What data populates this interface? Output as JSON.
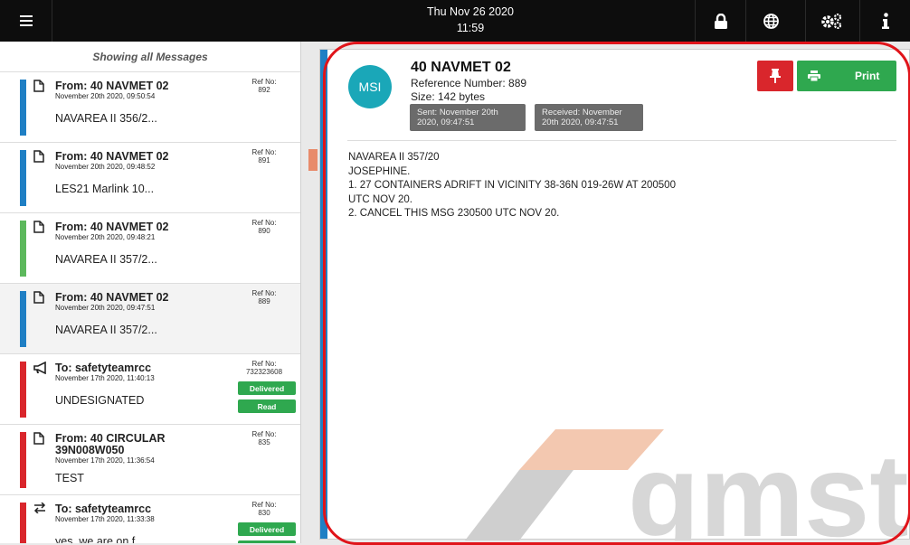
{
  "topbar": {
    "date": "Thu Nov 26 2020",
    "time": "11:59",
    "icons": [
      "menu-icon",
      "lock-icon",
      "globe-icon",
      "gears-icon",
      "info-icon"
    ]
  },
  "list": {
    "header": "Showing all Messages",
    "messages": [
      {
        "type": "file",
        "from": "From: 40 NAVMET 02",
        "date": "November 20th 2020, 09:50:54",
        "ref_label": "Ref No:",
        "ref": "892",
        "snippet": "NAVAREA II 356/2...",
        "color": "#1f7fc4",
        "selected": false,
        "badges": []
      },
      {
        "type": "file",
        "from": "From: 40 NAVMET 02",
        "date": "November 20th 2020, 09:48:52",
        "ref_label": "Ref No:",
        "ref": "891",
        "snippet": "LES21 Marlink 10...",
        "color": "#1f7fc4",
        "selected": false,
        "badges": []
      },
      {
        "type": "file",
        "from": "From: 40 NAVMET 02",
        "date": "November 20th 2020, 09:48:21",
        "ref_label": "Ref No:",
        "ref": "890",
        "snippet": "NAVAREA II 357/2...",
        "color": "#5cb85c",
        "selected": false,
        "badges": []
      },
      {
        "type": "file",
        "from": "From: 40 NAVMET 02",
        "date": "November 20th 2020, 09:47:51",
        "ref_label": "Ref No:",
        "ref": "889",
        "snippet": "NAVAREA II 357/2...",
        "color": "#1f7fc4",
        "selected": true,
        "badges": []
      },
      {
        "type": "megaphone",
        "from": "To: safetyteamrcc",
        "date": "November 17th 2020, 11:40:13",
        "ref_label": "Ref No:",
        "ref": "732323608",
        "snippet": "UNDESIGNATED",
        "color": "#d9262c",
        "selected": false,
        "badges": [
          "Delivered",
          "Read"
        ]
      },
      {
        "type": "file",
        "from": "From: 40 CIRCULAR 39N008W050",
        "date": "November 17th 2020, 11:36:54",
        "ref_label": "Ref No:",
        "ref": "835",
        "snippet": "TEST",
        "color": "#d9262c",
        "selected": false,
        "badges": []
      },
      {
        "type": "exchange",
        "from": "To: safetyteamrcc",
        "date": "November 17th 2020, 11:33:38",
        "ref_label": "Ref No:",
        "ref": "830",
        "snippet": "yes, we are on f...",
        "color": "#d9262c",
        "selected": false,
        "badges": [
          "Delivered",
          ""
        ]
      }
    ]
  },
  "detail": {
    "avatar": "MSI",
    "title": "40 NAVMET 02",
    "reference": "Reference Number: 889",
    "size": "Size: 142 bytes",
    "sent": "Sent: November 20th 2020, 09:47:51",
    "received": "Received: November 20th 2020, 09:47:51",
    "print_label": "Print",
    "body": "NAVAREA II 357/20\nJOSEPHINE.\n1. 27 CONTAINERS ADRIFT IN VICINITY 38-36N 019-26W AT 200500\nUTC NOV 20.\n2. CANCEL THIS MSG 230500 UTC NOV 20.",
    "watermark": "gmst"
  },
  "colors": {
    "topbar": "#0d0d0d",
    "green": "#2fa84f",
    "red": "#d9262c",
    "blue": "#1f7fc4",
    "teal": "#1aa7b8"
  }
}
